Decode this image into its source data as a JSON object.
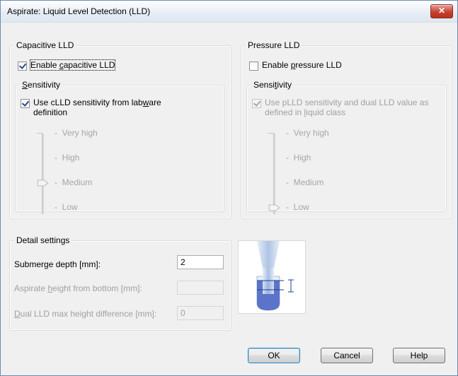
{
  "window": {
    "title": "Aspirate: Liquid Level Detection (LLD)",
    "close_glyph": "✕"
  },
  "capacitive": {
    "group_title": "Capacitive LLD",
    "enable": {
      "pre": "Enable ",
      "u": "c",
      "post": "apacitive LLD",
      "checked": true
    },
    "sensitivity_title": {
      "u": "S",
      "post": "ensitivity"
    },
    "use_labware": {
      "line1_pre": "Use cLLD sensitivity from lab",
      "line1_u": "w",
      "line1_post": "are",
      "line2": "definition",
      "checked": true
    },
    "levels": [
      "Very high",
      "High",
      "Medium",
      "Low"
    ],
    "selected_level": "Medium"
  },
  "pressure": {
    "group_title": "Pressure LLD",
    "enable": {
      "pre": "Enable ",
      "u": "p",
      "post": "ressure LLD",
      "checked": false
    },
    "sensitivity_title": {
      "pre": "Sensi",
      "u": "t",
      "post": "ivity"
    },
    "use_liquid_class": {
      "line1": "Use pLLD sensitivity and dual LLD value as",
      "line2_pre": "defined in ",
      "line2_u": "l",
      "line2_post": "iquid class",
      "checked": true
    },
    "levels": [
      "Very high",
      "High",
      "Medium",
      "Low"
    ],
    "selected_level": "Low"
  },
  "detail": {
    "group_title": "Detail settings",
    "submerge_label": "Submerge depth [mm]:",
    "submerge_value": "2",
    "aspirate_height_label": {
      "pre": "Aspirate ",
      "u": "h",
      "post": "eight from bottom [mm]:"
    },
    "aspirate_height_value": "",
    "dual_lld_label": {
      "u": "D",
      "post": "ual LLD max height difference [mm]:"
    },
    "dual_lld_value": "0"
  },
  "buttons": {
    "ok": "OK",
    "cancel": "Cancel",
    "help": "Help"
  },
  "colors": {
    "accent": "#3c7fb1",
    "liquid": "#5b74c9",
    "close": "#c7402f"
  }
}
